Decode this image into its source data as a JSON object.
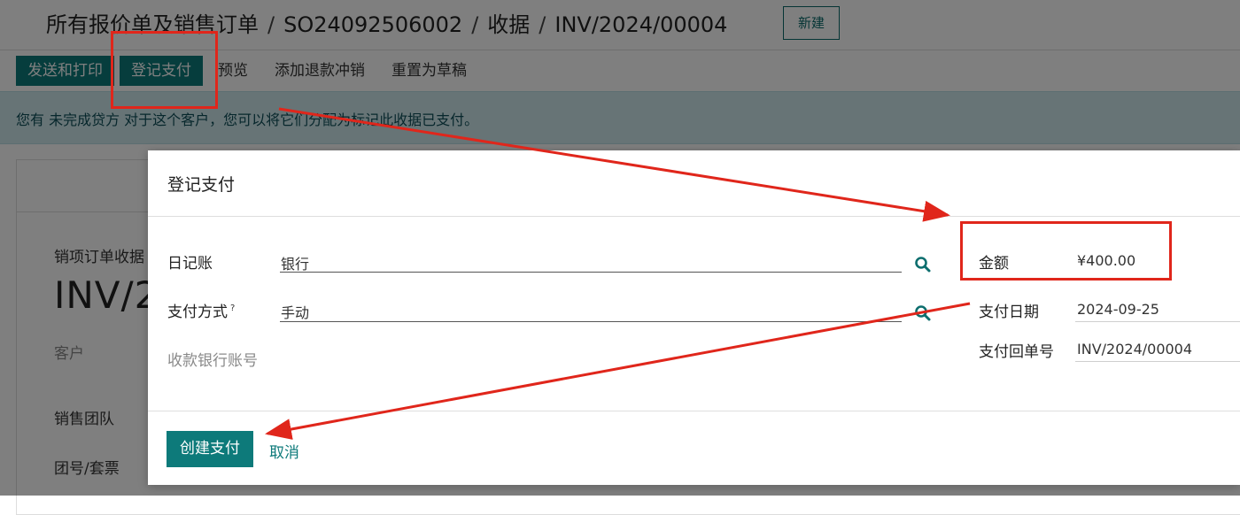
{
  "breadcrumb": {
    "items": [
      "所有报价单及销售订单",
      "SO24092506002",
      "收据",
      "INV/2024/00004"
    ],
    "separator": "/"
  },
  "header": {
    "new_button": "新建"
  },
  "action_bar": {
    "send_print": "发送和打印",
    "register_payment": "登记支付",
    "preview": "预览",
    "add_credit_note": "添加退款冲销",
    "reset_to_draft": "重置为草稿"
  },
  "alert": {
    "text": "您有 未完成贷方 对于这个客户，您可以将它们分配为标记此收据已支付。"
  },
  "background_form": {
    "doc_type": "销项订单收据",
    "doc_number_partial": "INV/2",
    "customer_label": "客户",
    "sales_team_label": "销售团队",
    "group_label": "团号/套票"
  },
  "modal": {
    "title": "登记支付",
    "journal": {
      "label": "日记账",
      "value": "银行"
    },
    "payment_method": {
      "label": "支付方式",
      "help": "?",
      "value": "手动"
    },
    "recipient_bank": {
      "label": "收款银行账号"
    },
    "amount": {
      "label": "金额",
      "value": "¥400.00"
    },
    "payment_date": {
      "label": "支付日期",
      "value": "2024-09-25"
    },
    "memo": {
      "label": "支付回单号",
      "value": "INV/2024/00004"
    },
    "create_button": "创建支付",
    "cancel_button": "取消"
  },
  "colors": {
    "primary": "#0d7a7a",
    "annotation": "#e0261b",
    "alert_bg": "#cfe8ec"
  }
}
